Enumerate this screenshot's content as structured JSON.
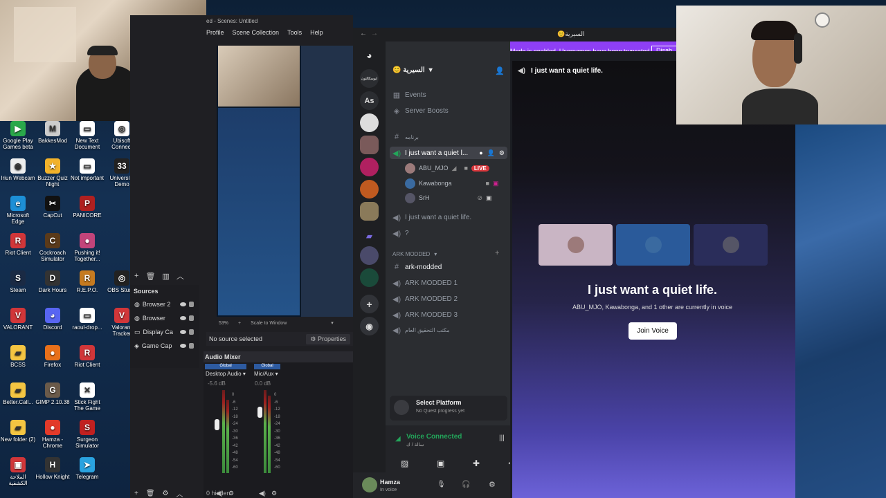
{
  "desktop": {
    "icons": [
      {
        "label": "Google Play Games beta",
        "color": "#2aa84a",
        "glyph": "▶"
      },
      {
        "label": "BakkesMod",
        "color": "#ccc",
        "glyph": "M"
      },
      {
        "label": "New Text Document",
        "color": "#fff",
        "glyph": "▭"
      },
      {
        "label": "Ubisoft Connect",
        "color": "#fff",
        "glyph": "◎"
      },
      {
        "label": "Iriun Webcam",
        "color": "#eee",
        "glyph": "◉"
      },
      {
        "label": "Buzzer Quiz Night",
        "color": "#f2b22a",
        "glyph": "★"
      },
      {
        "label": "Not important",
        "color": "#fff",
        "glyph": "▭"
      },
      {
        "label": "University Demo",
        "color": "#222",
        "glyph": "33"
      },
      {
        "label": "Microsoft Edge",
        "color": "#1d8fd6",
        "glyph": "e"
      },
      {
        "label": "CapCut",
        "color": "#111",
        "glyph": "✂"
      },
      {
        "label": "PANICORE",
        "color": "#b02020",
        "glyph": "P"
      },
      {
        "label": "Riot Client",
        "color": "#d13639",
        "glyph": "R"
      },
      {
        "label": "Cockroach Simulator",
        "color": "#5a3a1a",
        "glyph": "C"
      },
      {
        "label": "Pushing it! Together...",
        "color": "#c2447a",
        "glyph": "●"
      },
      {
        "label": "Steam",
        "color": "#1a2a44",
        "glyph": "S"
      },
      {
        "label": "Dark Hours",
        "color": "#333",
        "glyph": "D"
      },
      {
        "label": "R.E.P.O.",
        "color": "#c57a20",
        "glyph": "R"
      },
      {
        "label": "OBS Studio",
        "color": "#222",
        "glyph": "◎"
      },
      {
        "label": "VALORANT",
        "color": "#d13639",
        "glyph": "V"
      },
      {
        "label": "Discord",
        "color": "#5865f2",
        "glyph": "◕"
      },
      {
        "label": "raoul-drop...",
        "color": "#fff",
        "glyph": "▭"
      },
      {
        "label": "Valorant Tracker",
        "color": "#d13639",
        "glyph": "V"
      },
      {
        "label": "BCSS",
        "color": "#f4c542",
        "glyph": "▰"
      },
      {
        "label": "Firefox",
        "color": "#e8701a",
        "glyph": "●"
      },
      {
        "label": "Riot Client",
        "color": "#d13639",
        "glyph": "R"
      },
      {
        "label": "Better.Call...",
        "color": "#f4c542",
        "glyph": "▰"
      },
      {
        "label": "GIMP 2.10.38",
        "color": "#6a5a4a",
        "glyph": "G"
      },
      {
        "label": "Stick Fight The Game",
        "color": "#fff",
        "glyph": "✕"
      },
      {
        "label": "New folder (2)",
        "color": "#f4c542",
        "glyph": "▰"
      },
      {
        "label": "Hamza - Chrome",
        "color": "#e23a2a",
        "glyph": "●"
      },
      {
        "label": "Surgeon Simulator",
        "color": "#c02020",
        "glyph": "S"
      },
      {
        "label": "الملاحة الكشفية",
        "color": "#d13639",
        "glyph": "▣"
      },
      {
        "label": "Hollow Knight",
        "color": "#333",
        "glyph": "H"
      },
      {
        "label": "Telegram",
        "color": "#2aa3e0",
        "glyph": "➤"
      }
    ]
  },
  "obs": {
    "title": "ed - Scenes: Untitled",
    "menu": [
      "Profile",
      "Scene Collection",
      "Tools",
      "Help"
    ],
    "sources_title": "Sources",
    "sources": [
      "Browser 2",
      "Browser",
      "Display Ca",
      "Game Cap"
    ],
    "no_source": "No source selected",
    "properties": "Properties",
    "zoom": "53%",
    "scale": "Scale to Window",
    "audio_mixer": "Audio Mixer",
    "global1": "Global",
    "global2": "Global",
    "desktop_audio": "Desktop Audio",
    "mic_aux": "Mic/Aux",
    "desktop_db": "-5.6 dB",
    "mic_db": "0.0 dB",
    "db_ticks": [
      "0",
      "-6",
      "-12",
      "-18",
      "-24",
      "-30",
      "-36",
      "-42",
      "-48",
      "-54",
      "-60"
    ],
    "hidden": "0 hidden"
  },
  "discord": {
    "window_title": "😊السيرية",
    "banner": "Streamer Mode is enabled. Usernames have been truncated.",
    "banner_button": "Disab",
    "server_name": "😊 السيرية",
    "guild_text_as": "As",
    "guild_text_top": "ايوسكالتون",
    "events": "Events",
    "boosts": "Server Boosts",
    "channel_arabic": "برنامه",
    "active_voice": "I just want a quiet l...",
    "voice_users": [
      {
        "name": "ABU_MJO",
        "live": "LIVE",
        "avatar_color": "#9c7a7a"
      },
      {
        "name": "Kawabonga",
        "avatar_color": "#3a6aa0"
      },
      {
        "name": "SrH",
        "avatar_color": "#556"
      }
    ],
    "voice2": "I just want a quiet life.",
    "voice3": "?",
    "category": "ARK MODDED",
    "text_channel": "ark-modded",
    "ark1": "ARK MODDED 1",
    "ark2": "ARK MODDED 2",
    "ark3": "ARK MODDED 3",
    "ark_ar": "مكتب التحقيق العام",
    "select_platform": "Select Platform",
    "no_quest": "No Quest progress yet",
    "voice_connected": "Voice Connected",
    "voice_sub": "سالة / ك",
    "user_name": "Hamza",
    "user_status": "In voice",
    "header_channel": "I just want a quiet life.",
    "big_title": "I just want a quiet life.",
    "in_voice": "ABU_MJO, Kawabonga, and 1 other are currently in voice",
    "join_voice": "Join Voice"
  },
  "colors": {
    "discord_blurple": "#5865f2",
    "streamer_banner": "#8e3ff5",
    "voice_green": "#23a55a",
    "live_red": "#da373c"
  }
}
